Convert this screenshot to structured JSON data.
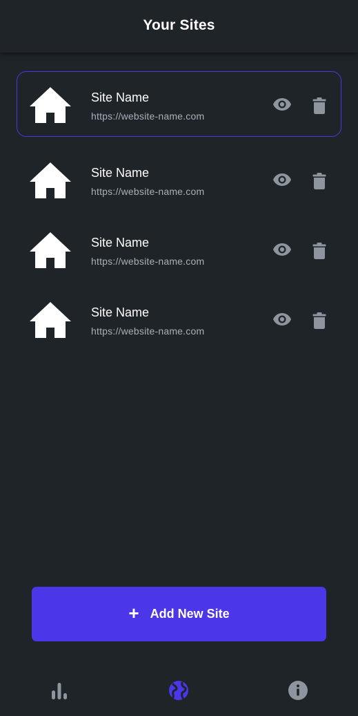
{
  "header": {
    "title": "Your Sites"
  },
  "sites": [
    {
      "name": "Site Name",
      "url": "https://website-name.com",
      "selected": true
    },
    {
      "name": "Site Name",
      "url": "https://website-name.com",
      "selected": false
    },
    {
      "name": "Site Name",
      "url": "https://website-name.com",
      "selected": false
    },
    {
      "name": "Site Name",
      "url": "https://website-name.com",
      "selected": false
    }
  ],
  "add_button": {
    "icon": "plus-icon",
    "label": "Add New Site"
  },
  "bottom_nav": {
    "items": [
      {
        "name": "stats",
        "icon": "bar-chart-icon",
        "active": false
      },
      {
        "name": "sites",
        "icon": "globe-icon",
        "active": true
      },
      {
        "name": "info",
        "icon": "info-icon",
        "active": false
      }
    ]
  },
  "colors": {
    "background": "#1f2429",
    "accent": "#4b36e8",
    "icon_muted": "#8e959e",
    "text_secondary": "#aab0b8"
  }
}
